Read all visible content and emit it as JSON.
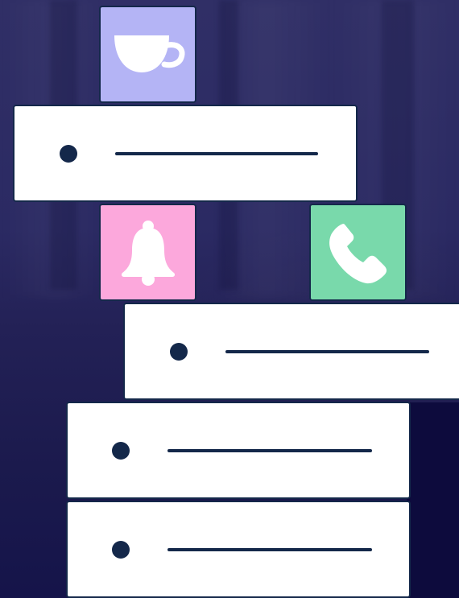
{
  "colors": {
    "background": "#25235a",
    "card_border": "#14284a",
    "card_fill": "#ffffff"
  },
  "tiles": [
    {
      "icon": "coffee-cup-icon",
      "color": "#b4b4f5"
    },
    {
      "icon": "bell-icon",
      "color": "#fca8dc"
    },
    {
      "icon": "phone-icon",
      "color": "#79d9ab"
    }
  ],
  "list_items": [
    {
      "placeholder": "bullet-with-line"
    },
    {
      "placeholder": "bullet-with-line"
    },
    {
      "placeholder": "bullet-with-line"
    },
    {
      "placeholder": "bullet-with-line"
    }
  ]
}
